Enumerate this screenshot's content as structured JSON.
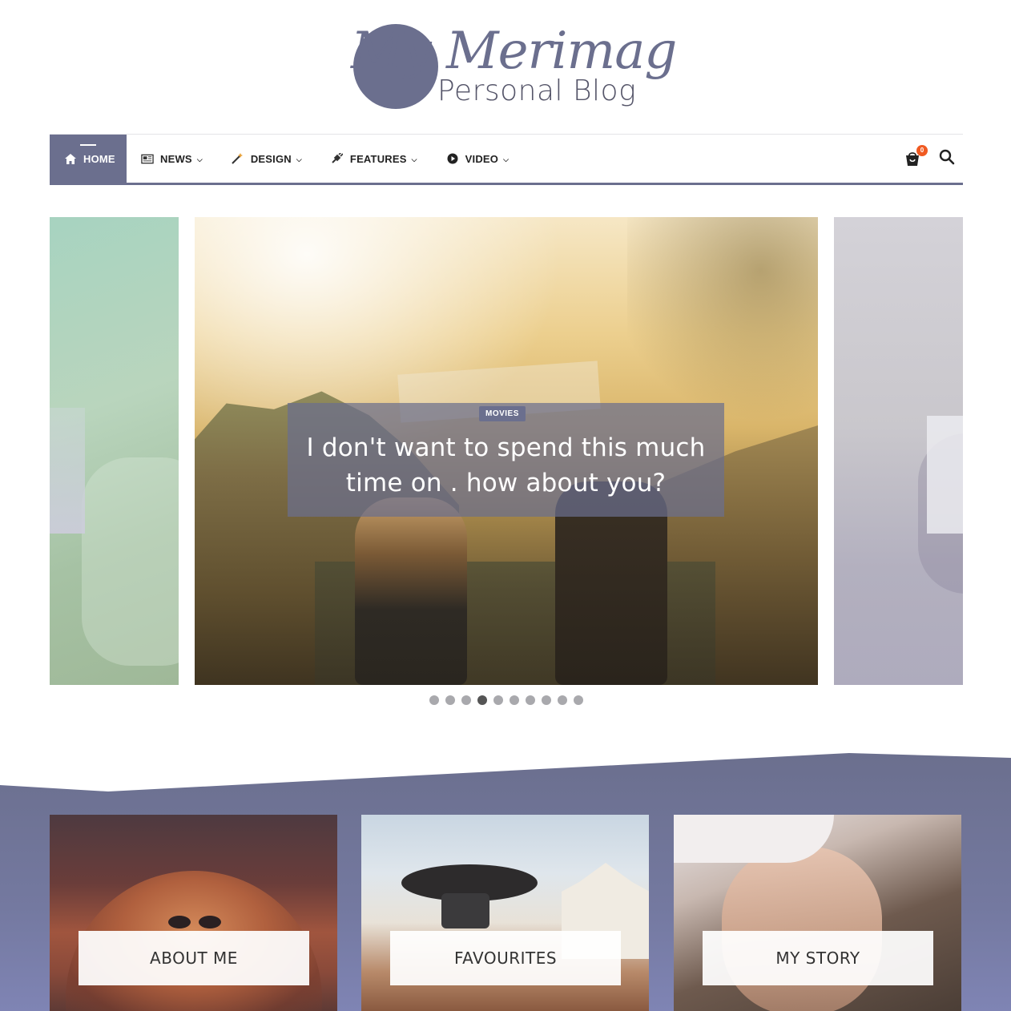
{
  "logo": {
    "script": "My Merimag",
    "subtitle": "Personal Blog"
  },
  "nav": {
    "items": [
      {
        "label": "HOME",
        "icon": "home-icon",
        "active": true
      },
      {
        "label": "NEWS",
        "icon": "newspaper-icon",
        "dropdown": true
      },
      {
        "label": "DESIGN",
        "icon": "magic-wand-icon",
        "dropdown": true
      },
      {
        "label": "FEATURES",
        "icon": "plug-icon",
        "dropdown": true
      },
      {
        "label": "VIDEO",
        "icon": "play-circle-icon",
        "dropdown": true
      }
    ],
    "cart_count": "0",
    "accent_color": "#6b6f8e",
    "badge_color": "#f05a22"
  },
  "slider": {
    "category": "MOVIES",
    "headline": "I don't want to spend this much time on . how about you?",
    "dots_total": 10,
    "active_dot": 4
  },
  "cards": [
    {
      "label": "ABOUT ME"
    },
    {
      "label": "FAVOURITES"
    },
    {
      "label": "MY STORY"
    }
  ]
}
